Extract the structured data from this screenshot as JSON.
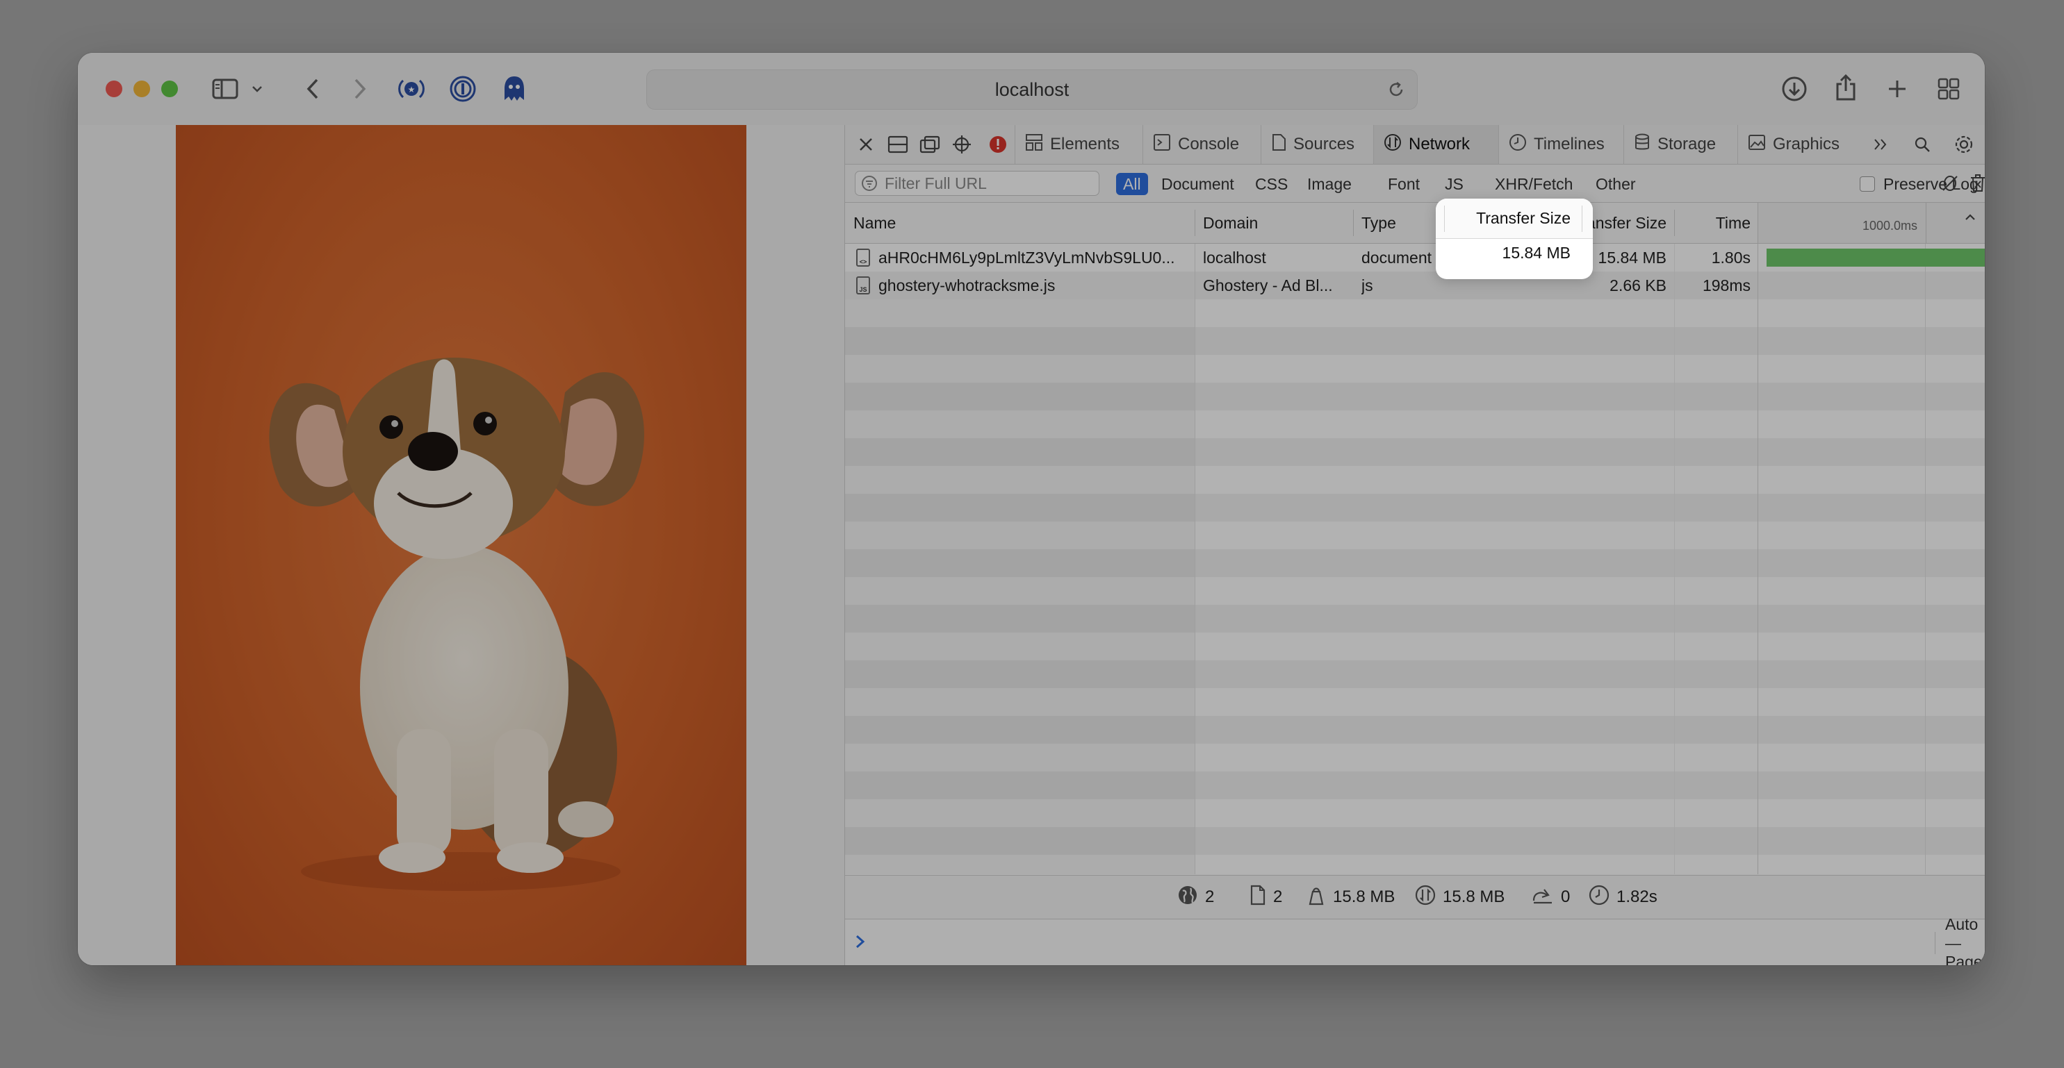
{
  "browser": {
    "url": "localhost"
  },
  "devtools": {
    "tabs": [
      {
        "label": "Elements",
        "icon": "elements-icon"
      },
      {
        "label": "Console",
        "icon": "console-icon"
      },
      {
        "label": "Sources",
        "icon": "sources-icon"
      },
      {
        "label": "Network",
        "icon": "network-icon",
        "active": true
      },
      {
        "label": "Timelines",
        "icon": "timelines-icon"
      },
      {
        "label": "Storage",
        "icon": "storage-icon"
      },
      {
        "label": "Graphics",
        "icon": "graphics-icon"
      }
    ],
    "filter": {
      "placeholder": "Filter Full URL",
      "types": [
        "All",
        "Document",
        "CSS",
        "Image",
        "Font",
        "JS",
        "XHR/Fetch",
        "Other"
      ],
      "active_type": "All",
      "preserve_log": "Preserve Log"
    },
    "columns": {
      "name": "Name",
      "domain": "Domain",
      "type": "Type",
      "transfer_size": "Transfer Size",
      "time": "Time",
      "waterfall_tick": "1000.0ms"
    },
    "rows": [
      {
        "name": "aHR0cHM6Ly9pLmltZ3VyLmNvbS9LU0...",
        "domain": "localhost",
        "type": "document",
        "transfer_size": "15.84 MB",
        "time": "1.80s",
        "icon": "document-file-icon"
      },
      {
        "name": "ghostery-whotracksme.js",
        "domain": "Ghostery - Ad Bl...",
        "type": "js",
        "transfer_size": "2.66 KB",
        "time": "198ms",
        "icon": "js-file-icon"
      }
    ],
    "summary": {
      "domains": "2",
      "resources": "2",
      "size": "15.8 MB",
      "transferred": "15.8 MB",
      "redirects": "0",
      "load_time": "1.82s"
    },
    "console": {
      "context": "Auto — Page"
    }
  },
  "colors": {
    "waterfall_waiting": "#6fc76a",
    "waterfall_receiving": "#5c93d1",
    "active_filter": "#2f6fe0",
    "error_badge": "#d9342b"
  }
}
